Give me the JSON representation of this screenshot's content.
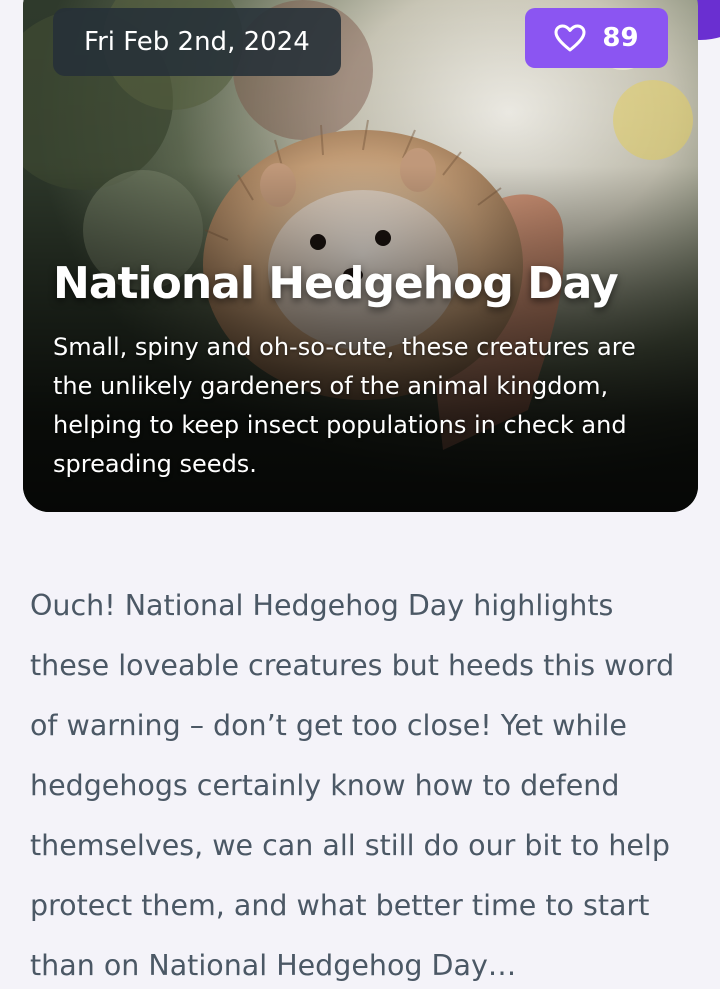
{
  "theme": {
    "accent": "#8b55f2",
    "accent_dark": "#6a2fd1",
    "body_text": "#4b5865",
    "page_bg": "#f4f3f9"
  },
  "hero": {
    "date": "Fri Feb 2nd, 2024",
    "likes": "89",
    "like_icon": "heart-outline-icon",
    "title": "National Hedgehog Day",
    "description": "Small, spiny and oh-so-cute, these creatures are the unlikely gardeners of the animal kingdom, helping to keep insect populations in check and spreading seeds."
  },
  "article": {
    "body": "Ouch! National Hedgehog Day highlights these loveable creatures but heeds this word of warning – don’t get too close! Yet while hedgehogs certainly know how to defend themselves, we can all still do our bit to help protect them, and what better time to start than on National Hedgehog Day…"
  }
}
